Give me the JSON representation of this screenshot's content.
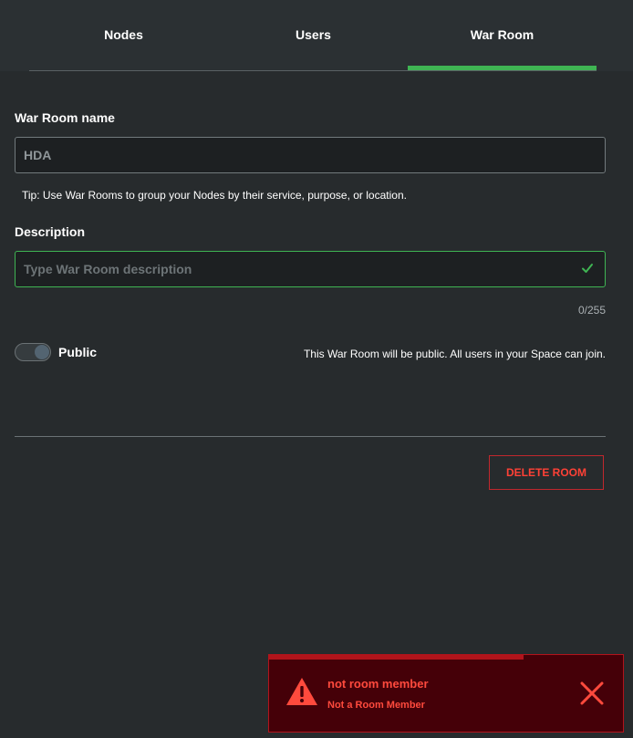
{
  "tabs": [
    {
      "label": "Nodes",
      "active": false
    },
    {
      "label": "Users",
      "active": false
    },
    {
      "label": "War Room",
      "active": true
    }
  ],
  "form": {
    "name_label": "War Room name",
    "name_value": "HDA",
    "tip": "Tip: Use War Rooms to group your Nodes by their service, purpose, or location.",
    "description_label": "Description",
    "description_value": "",
    "description_placeholder": "Type War Room description",
    "description_counter": "0/255",
    "public_label": "Public",
    "public_help": "This War Room will be public. All users in your Space can join.",
    "public_enabled": true
  },
  "actions": {
    "delete_label": "DELETE ROOM"
  },
  "toast": {
    "title": "not room member",
    "message": "Not a Room Member",
    "progress": 0.72
  },
  "colors": {
    "accent": "#3fb453",
    "danger": "#ff4136",
    "background": "#272b2d",
    "toast_background": "#450008"
  },
  "icons": {
    "valid": "check-icon",
    "toast": "warning-icon",
    "dismiss": "close-icon"
  }
}
